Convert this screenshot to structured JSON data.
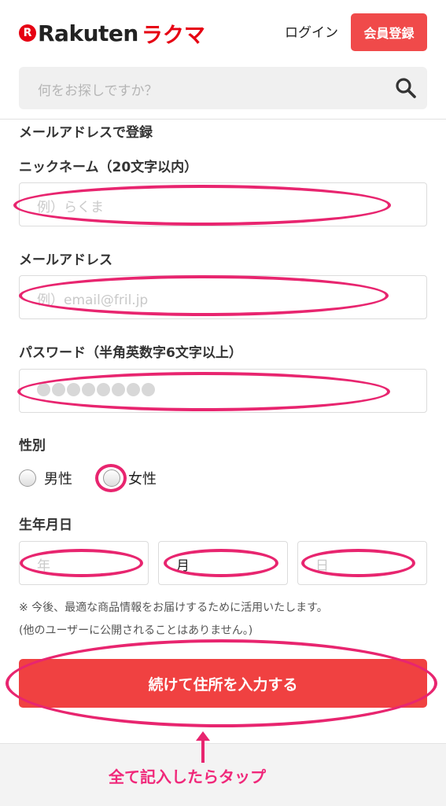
{
  "header": {
    "logo_r": "R",
    "logo_word": "Rakuten",
    "logo_sub": "ラクマ",
    "login_label": "ログイン",
    "signup_label": "会員登録",
    "search_placeholder": "何をお探しですか？"
  },
  "form": {
    "section_title": "メールアドレスで登録",
    "nickname_label": "ニックネーム（20文字以内）",
    "nickname_placeholder": "例）らくま",
    "email_label": "メールアドレス",
    "email_placeholder": "例）email@fril.jp",
    "password_label": "パスワード（半角英数字6文字以上）",
    "password_mask_count": 8,
    "gender_label": "性別",
    "gender_options": [
      "男性",
      "女性"
    ],
    "birthdate_label": "生年月日",
    "birth_year_placeholder": "年",
    "birth_month_value": "月",
    "birth_day_placeholder": "日",
    "note_line1": "※ 今後、最適な商品情報をお届けするために活用いたします。",
    "note_line2": "(他のユーザーに公開されることはありません。)",
    "submit_label": "続けて住所を入力する"
  },
  "annotation": {
    "tap_label": "全て記入したらタップ",
    "color": "#e8256f"
  },
  "colors": {
    "brand_red": "#e60012",
    "button_red": "#f04141"
  }
}
